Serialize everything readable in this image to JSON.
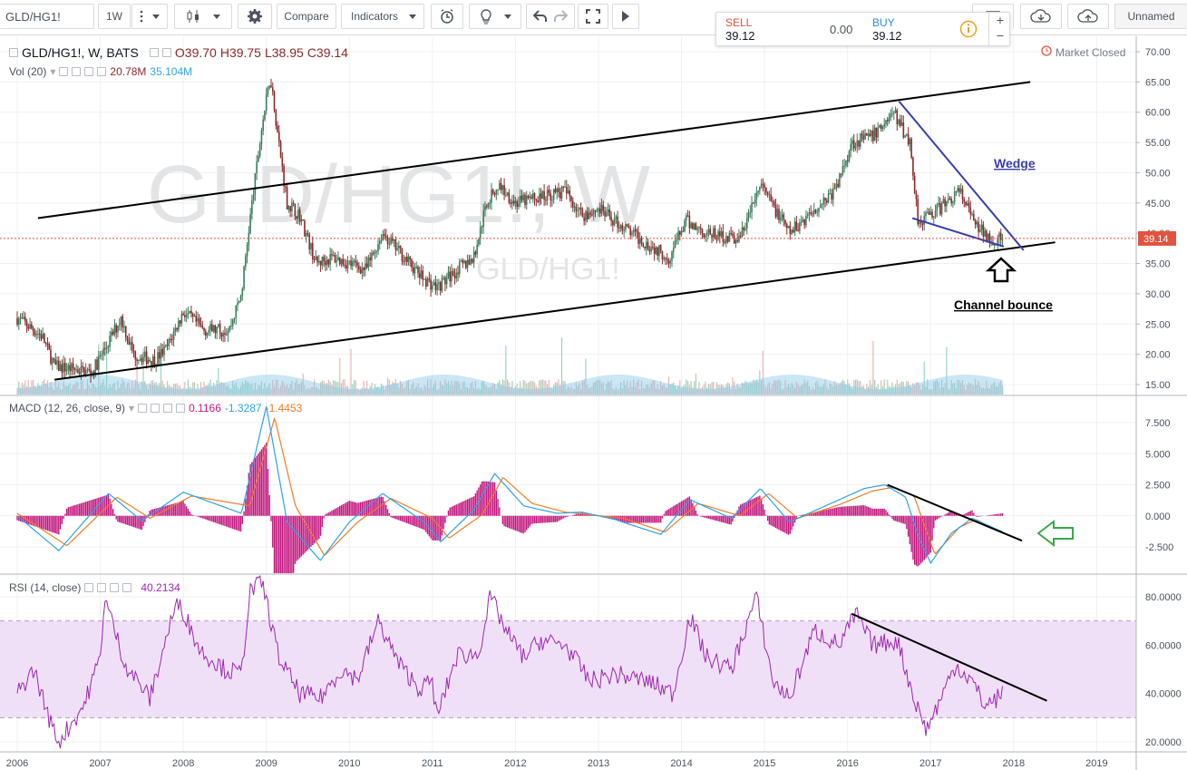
{
  "toolbar": {
    "symbol": "GLD/HG1!",
    "interval": "1W",
    "compare_label": "Compare",
    "indicators_label": "Indicators",
    "layout_label": "Unnamed"
  },
  "trade": {
    "sell_label": "SELL",
    "sell_price": "39.12",
    "spread": "0.00",
    "buy_label": "BUY",
    "buy_price": "39.12"
  },
  "main_legend": {
    "title": "GLD/HG1!, W, BATS",
    "open": "O39.70",
    "high": "H39.75",
    "low": "L38.95",
    "close": "C39.14"
  },
  "vol_legend": {
    "label": "Vol (20)",
    "v1": "20.78M",
    "v2": "35.104M"
  },
  "macd_legend": {
    "label": "MACD (12, 26, close, 9)",
    "hist": "0.1166",
    "macd": "-1.3287",
    "signal": "-1.4453"
  },
  "rsi_legend": {
    "label": "RSI (14, close)",
    "value": "40.2134"
  },
  "market_status": "Market Closed",
  "watermark": {
    "big": "GLD/HG1!, W",
    "small": "GLD/HG1!"
  },
  "annotations": {
    "wedge": "Wedge",
    "bounce": "Channel bounce"
  },
  "last_price": "39.14",
  "colors": {
    "up": "#3c7d5d",
    "down": "#8b2b2b",
    "volume": "#8cc7e8",
    "macd": "#2ea3e6",
    "signal": "#f07c27",
    "hist": "#c2187f",
    "rsi": "#9c27b0",
    "rsi_band": "#f0e0f7",
    "wedge": "#3a3fa8",
    "price_tag": "#e0533f"
  },
  "chart_data": [
    {
      "type": "candlestick",
      "title": "GLD/HG1!, W, BATS",
      "ylim": [
        14,
        71
      ],
      "y_ticks": [
        "70.00",
        "65.00",
        "60.00",
        "55.00",
        "50.00",
        "45.00",
        "40.00",
        "35.00",
        "30.00",
        "25.00",
        "20.00",
        "15.00"
      ],
      "x_ticks": [
        "2006",
        "2007",
        "2008",
        "2009",
        "2010",
        "2011",
        "2012",
        "2013",
        "2014",
        "2015",
        "2016",
        "2017",
        "2018",
        "2019"
      ],
      "approx_close_path": [
        [
          2006.0,
          26
        ],
        [
          2006.3,
          23
        ],
        [
          2006.45,
          18
        ],
        [
          2006.7,
          17.5
        ],
        [
          2006.9,
          17
        ],
        [
          2007.1,
          22
        ],
        [
          2007.25,
          26
        ],
        [
          2007.4,
          20
        ],
        [
          2007.65,
          19
        ],
        [
          2007.8,
          21
        ],
        [
          2008.0,
          27
        ],
        [
          2008.25,
          24
        ],
        [
          2008.55,
          24
        ],
        [
          2008.7,
          30
        ],
        [
          2008.8,
          42
        ],
        [
          2008.95,
          58
        ],
        [
          2009.05,
          66
        ],
        [
          2009.15,
          55
        ],
        [
          2009.25,
          45
        ],
        [
          2009.4,
          43
        ],
        [
          2009.6,
          35
        ],
        [
          2009.8,
          36
        ],
        [
          2010.0,
          35
        ],
        [
          2010.2,
          34
        ],
        [
          2010.4,
          40
        ],
        [
          2010.6,
          37
        ],
        [
          2010.85,
          33
        ],
        [
          2011.05,
          31
        ],
        [
          2011.3,
          34
        ],
        [
          2011.5,
          36
        ],
        [
          2011.65,
          45
        ],
        [
          2011.8,
          48
        ],
        [
          2012.0,
          45
        ],
        [
          2012.3,
          46
        ],
        [
          2012.6,
          47
        ],
        [
          2012.8,
          43
        ],
        [
          2013.0,
          44
        ],
        [
          2013.2,
          42
        ],
        [
          2013.5,
          39
        ],
        [
          2013.85,
          36
        ],
        [
          2014.05,
          42
        ],
        [
          2014.3,
          40
        ],
        [
          2014.7,
          39
        ],
        [
          2014.95,
          48
        ],
        [
          2015.3,
          40
        ],
        [
          2015.6,
          44
        ],
        [
          2015.85,
          47
        ],
        [
          2016.05,
          55
        ],
        [
          2016.3,
          56
        ],
        [
          2016.55,
          60
        ],
        [
          2016.75,
          55
        ],
        [
          2016.85,
          42
        ],
        [
          2017.1,
          44
        ],
        [
          2017.35,
          47
        ],
        [
          2017.55,
          41
        ],
        [
          2017.75,
          39
        ],
        [
          2017.88,
          39.14
        ]
      ],
      "channel_upper": [
        [
          2006.25,
          42.5
        ],
        [
          2018.2,
          65
        ]
      ],
      "channel_lower": [
        [
          2006.45,
          15.8
        ],
        [
          2018.5,
          38.5
        ]
      ],
      "wedge_upper": [
        [
          2016.62,
          61.8
        ],
        [
          2018.12,
          37.2
        ]
      ],
      "wedge_lower": [
        [
          2016.78,
          42.5
        ],
        [
          2017.88,
          37.8
        ]
      ],
      "last": 39.14
    },
    {
      "type": "bar",
      "name": "Vol (20)",
      "values_label": [
        "20.78M",
        "35.104M"
      ]
    },
    {
      "type": "line",
      "name": "MACD (12, 26, close, 9)",
      "ylim": [
        -4.2,
        9.3
      ],
      "y_ticks": [
        "7.500",
        "5.000",
        "2.500",
        "0.000",
        "-2.500"
      ],
      "macd_path": [
        [
          2006.0,
          0
        ],
        [
          2006.5,
          -2.8
        ],
        [
          2007.1,
          1.8
        ],
        [
          2007.5,
          -0.4
        ],
        [
          2008.0,
          1.9
        ],
        [
          2008.7,
          0.2
        ],
        [
          2009.0,
          8.8
        ],
        [
          2009.25,
          -0.5
        ],
        [
          2009.65,
          -3.6
        ],
        [
          2010.0,
          -0.5
        ],
        [
          2010.4,
          1.8
        ],
        [
          2010.9,
          -0.5
        ],
        [
          2011.1,
          -2.1
        ],
        [
          2011.5,
          0.5
        ],
        [
          2011.75,
          3.4
        ],
        [
          2012.1,
          0.8
        ],
        [
          2012.5,
          0.2
        ],
        [
          2012.8,
          0.3
        ],
        [
          2013.2,
          -0.3
        ],
        [
          2013.75,
          -1.5
        ],
        [
          2014.1,
          1.3
        ],
        [
          2014.6,
          -0.2
        ],
        [
          2014.95,
          2.2
        ],
        [
          2015.3,
          -0.5
        ],
        [
          2015.8,
          1.0
        ],
        [
          2016.2,
          2.2
        ],
        [
          2016.45,
          2.5
        ],
        [
          2016.7,
          1.5
        ],
        [
          2016.85,
          -1.6
        ],
        [
          2017.0,
          -3.8
        ],
        [
          2017.25,
          -1.4
        ],
        [
          2017.5,
          -0.2
        ],
        [
          2017.88,
          -1.33
        ]
      ],
      "signal_path": [
        [
          2006.0,
          0.2
        ],
        [
          2006.6,
          -2.4
        ],
        [
          2007.2,
          1.5
        ],
        [
          2007.6,
          -0.2
        ],
        [
          2008.1,
          1.6
        ],
        [
          2008.8,
          0.8
        ],
        [
          2009.1,
          7.9
        ],
        [
          2009.35,
          0.8
        ],
        [
          2009.7,
          -3.2
        ],
        [
          2010.1,
          -0.5
        ],
        [
          2010.5,
          1.4
        ],
        [
          2011.0,
          -0.2
        ],
        [
          2011.2,
          -1.8
        ],
        [
          2011.6,
          0.1
        ],
        [
          2011.85,
          3.1
        ],
        [
          2012.2,
          1.0
        ],
        [
          2012.6,
          0.3
        ],
        [
          2013.3,
          -0.2
        ],
        [
          2013.8,
          -1.3
        ],
        [
          2014.2,
          1.0
        ],
        [
          2014.7,
          0.0
        ],
        [
          2015.05,
          1.8
        ],
        [
          2015.4,
          -0.2
        ],
        [
          2015.9,
          0.9
        ],
        [
          2016.3,
          2.0
        ],
        [
          2016.55,
          2.3
        ],
        [
          2016.8,
          1.6
        ],
        [
          2016.95,
          -1.2
        ],
        [
          2017.05,
          -3.1
        ],
        [
          2017.35,
          -0.9
        ],
        [
          2017.55,
          -0.3
        ],
        [
          2017.88,
          -1.45
        ]
      ],
      "trendline": [
        [
          2016.48,
          2.5
        ],
        [
          2018.1,
          -2.0
        ]
      ]
    },
    {
      "type": "line",
      "name": "RSI (14, close)",
      "ylim": [
        17,
        87
      ],
      "y_ticks": [
        "80.0000",
        "60.0000",
        "40.0000",
        "20.0000"
      ],
      "band": [
        30,
        70
      ],
      "rsi_path": [
        [
          2006.0,
          40
        ],
        [
          2006.2,
          50
        ],
        [
          2006.4,
          28
        ],
        [
          2006.5,
          20
        ],
        [
          2006.8,
          35
        ],
        [
          2007.0,
          55
        ],
        [
          2007.05,
          80
        ],
        [
          2007.3,
          52
        ],
        [
          2007.6,
          38
        ],
        [
          2007.85,
          70
        ],
        [
          2007.95,
          78
        ],
        [
          2008.2,
          58
        ],
        [
          2008.5,
          50
        ],
        [
          2008.7,
          48
        ],
        [
          2008.8,
          82
        ],
        [
          2008.95,
          86
        ],
        [
          2009.15,
          55
        ],
        [
          2009.4,
          40
        ],
        [
          2009.65,
          38
        ],
        [
          2009.9,
          50
        ],
        [
          2010.1,
          46
        ],
        [
          2010.35,
          70
        ],
        [
          2010.6,
          52
        ],
        [
          2010.85,
          42
        ],
        [
          2011.0,
          45
        ],
        [
          2011.05,
          30
        ],
        [
          2011.3,
          56
        ],
        [
          2011.55,
          56
        ],
        [
          2011.7,
          80
        ],
        [
          2011.9,
          65
        ],
        [
          2012.1,
          55
        ],
        [
          2012.3,
          62
        ],
        [
          2012.6,
          60
        ],
        [
          2012.9,
          45
        ],
        [
          2013.2,
          48
        ],
        [
          2013.6,
          45
        ],
        [
          2013.9,
          40
        ],
        [
          2014.1,
          72
        ],
        [
          2014.3,
          55
        ],
        [
          2014.6,
          50
        ],
        [
          2014.9,
          80
        ],
        [
          2015.1,
          45
        ],
        [
          2015.3,
          38
        ],
        [
          2015.6,
          66
        ],
        [
          2015.9,
          60
        ],
        [
          2016.1,
          73
        ],
        [
          2016.3,
          60
        ],
        [
          2016.6,
          62
        ],
        [
          2016.8,
          38
        ],
        [
          2016.95,
          25
        ],
        [
          2017.15,
          40
        ],
        [
          2017.3,
          52
        ],
        [
          2017.5,
          45
        ],
        [
          2017.65,
          35
        ],
        [
          2017.8,
          38
        ],
        [
          2017.88,
          40.21
        ]
      ],
      "trendline": [
        [
          2016.05,
          73
        ],
        [
          2018.4,
          37
        ]
      ]
    }
  ]
}
